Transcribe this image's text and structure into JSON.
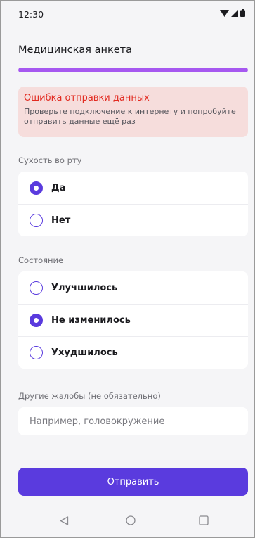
{
  "status_bar": {
    "time": "12:30",
    "icons": [
      "wifi-icon",
      "signal-icon",
      "battery-icon"
    ]
  },
  "header": {
    "title": "Медицинская анкета",
    "progress": 1.0
  },
  "error": {
    "title": "Ошибка отправки данных",
    "text": "Проверьте подключение к интернету и попробуйте отправить данные ещё раз"
  },
  "dry_mouth": {
    "label": "Сухость во рту",
    "options": [
      {
        "label": "Да",
        "checked": true
      },
      {
        "label": "Нет",
        "checked": false
      }
    ]
  },
  "condition": {
    "label": "Состояние",
    "options": [
      {
        "label": "Улучшилось",
        "checked": false
      },
      {
        "label": "Не изменилось",
        "checked": true
      },
      {
        "label": "Ухудшилось",
        "checked": false
      }
    ]
  },
  "complaints": {
    "label": "Другие жалобы (не обязательно)",
    "value": "",
    "placeholder": "Например, головокружение"
  },
  "submit_label": "Отправить",
  "nav": {
    "icons": [
      "back-icon",
      "home-icon",
      "recents-icon"
    ]
  },
  "colors": {
    "accent": "#5a3bde",
    "progress": "#a658f0",
    "error_bg": "#f6dddc",
    "error_text": "#e22a20",
    "background": "#f5f5f7"
  }
}
